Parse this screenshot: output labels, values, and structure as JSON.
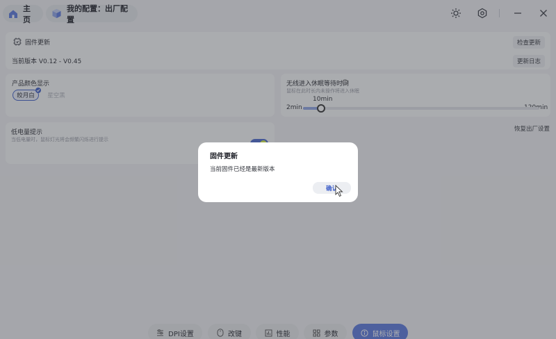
{
  "topbar": {
    "home_label": "主页",
    "config_label": "我的配置：出厂配置",
    "icons": [
      "home-icon",
      "cube-icon",
      "brightness-icon",
      "settings-icon",
      "minimize-icon",
      "close-icon"
    ]
  },
  "firmware": {
    "title": "固件更新",
    "check_button": "检查更新",
    "version_label": "当前版本 V0.12 - V0.45",
    "changelog_button": "更新日志"
  },
  "product_color": {
    "title": "产品颜色显示",
    "options": [
      "皎月白",
      "星空黑"
    ],
    "selected": "皎月白"
  },
  "sleep": {
    "title": "无线进入休眠等待时间",
    "desc": "鼠标在此时长内未操作将进入休眠",
    "min_label": "2min",
    "max_label": "120min",
    "value_label": "10min",
    "min": 2,
    "max": 120,
    "value": 10
  },
  "low_battery": {
    "title": "低电量提示",
    "desc": "当低电量时，鼠标灯光将会频繁闪烁进行提示",
    "enabled": true
  },
  "factory_reset_button": "恢复出厂设置",
  "bottom_nav": {
    "items": [
      {
        "label": "DPI设置",
        "icon": "dpi-icon"
      },
      {
        "label": "改键",
        "icon": "mouse-icon"
      },
      {
        "label": "性能",
        "icon": "performance-icon"
      },
      {
        "label": "参数",
        "icon": "grid-icon"
      },
      {
        "label": "鼠标设置",
        "icon": "info-icon"
      }
    ],
    "active": "鼠标设置"
  },
  "dialog": {
    "title": "固件更新",
    "message": "当前固件已经是最新版本",
    "confirm": "确认"
  },
  "colors": {
    "accent": "#5b79de",
    "dialog_bg": "#ffffff",
    "overlay": "rgba(60,62,68,0.42)"
  }
}
